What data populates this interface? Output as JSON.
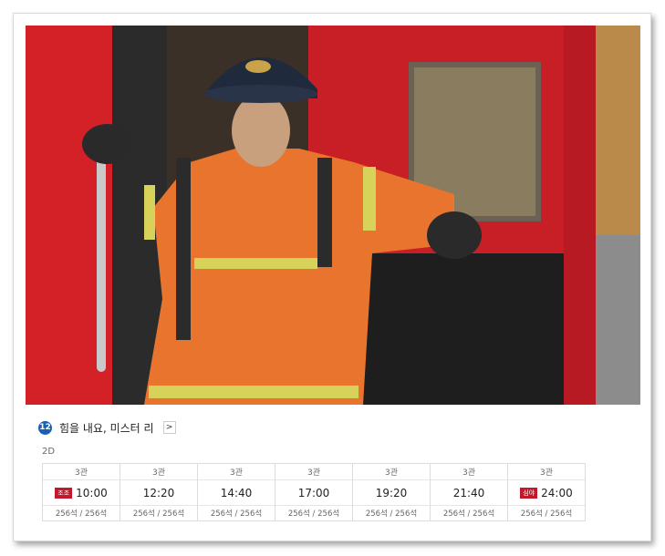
{
  "movie": {
    "age_rating": "12",
    "title": "힘을 내요, 미스터 리",
    "detail_arrow": ">",
    "format": "2D"
  },
  "showtimes": [
    {
      "hall": "3관",
      "tag": "조조",
      "time": "10:00",
      "seats": "256석 / 256석"
    },
    {
      "hall": "3관",
      "tag": "",
      "time": "12:20",
      "seats": "256석 / 256석"
    },
    {
      "hall": "3관",
      "tag": "",
      "time": "14:40",
      "seats": "256석 / 256석"
    },
    {
      "hall": "3관",
      "tag": "",
      "time": "17:00",
      "seats": "256석 / 256석"
    },
    {
      "hall": "3관",
      "tag": "",
      "time": "19:20",
      "seats": "256석 / 256석"
    },
    {
      "hall": "3관",
      "tag": "",
      "time": "21:40",
      "seats": "256석 / 256석"
    },
    {
      "hall": "3관",
      "tag": "심야",
      "time": "24:00",
      "seats": "256석 / 256석"
    }
  ],
  "colors": {
    "age_badge": "#1a5fb4",
    "time_tag": "#c4172c",
    "truck_red": "#d42128",
    "suit_orange": "#e8742e"
  }
}
